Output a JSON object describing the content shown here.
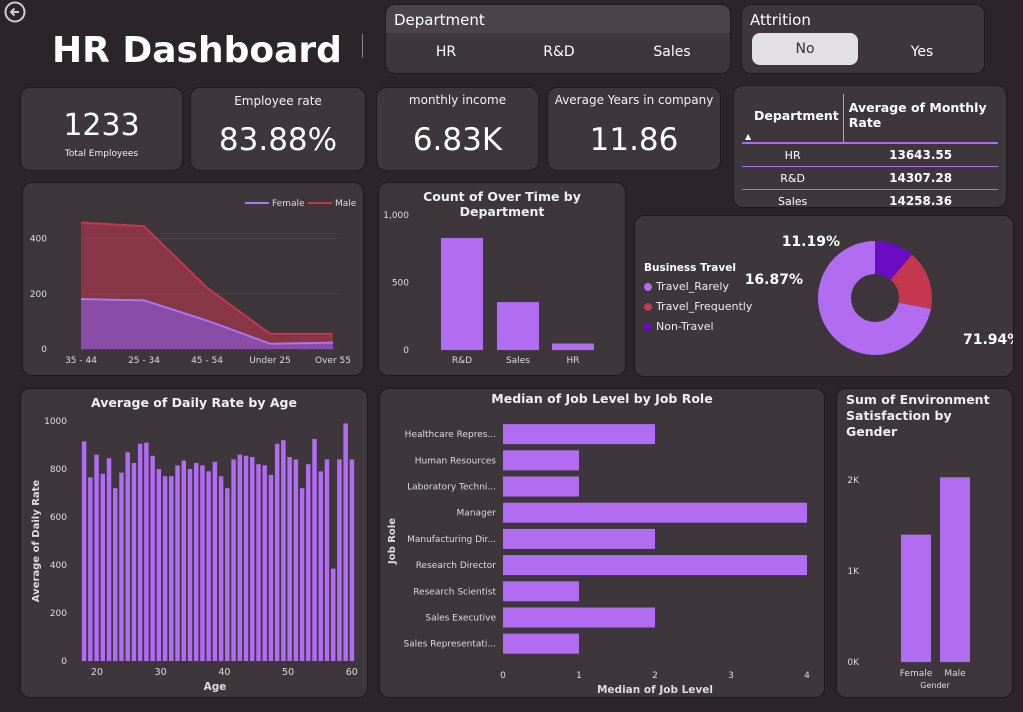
{
  "title": "HR Dashboard",
  "back_icon": "back-arrow-icon",
  "colors": {
    "purple": "#b26cf2",
    "female_line": "#a876ee",
    "male_line": "#c5374f",
    "travel_rarely": "#b26cf2",
    "travel_frequently": "#c5374f",
    "non_travel": "#6a0bc5"
  },
  "department_slicer": {
    "title": "Department",
    "items": [
      "HR",
      "R&D",
      "Sales"
    ]
  },
  "attrition_slicer": {
    "title": "Attrition",
    "items": [
      "No",
      "Yes"
    ],
    "selected": "No"
  },
  "kpis": {
    "total": {
      "value": "1233",
      "label": "Total Employees"
    },
    "employee_rate": {
      "label": "Employee rate",
      "value": "83.88%"
    },
    "monthly_income": {
      "label": "monthly income",
      "value": "6.83K"
    },
    "avg_years": {
      "label": "Average Years in company",
      "value": "11.86"
    }
  },
  "dept_table": {
    "headers": [
      "Department",
      "Average of Monthly Rate"
    ],
    "rows": [
      {
        "dept": "HR",
        "value": "13643.55"
      },
      {
        "dept": "R&D",
        "value": "14307.28"
      },
      {
        "dept": "Sales",
        "value": "14258.36"
      }
    ]
  },
  "chart_data": [
    {
      "type": "area",
      "title": "",
      "categories": [
        "35 - 44",
        "25 - 34",
        "45 - 54",
        "Under 25",
        "Over 55"
      ],
      "series": [
        {
          "name": "Female",
          "values": [
            181,
            176,
            103,
            19,
            23
          ]
        },
        {
          "name": "Male",
          "values": [
            458,
            445,
            222,
            55,
            55
          ]
        }
      ],
      "y_ticks": [
        "0",
        "200",
        "400"
      ],
      "ylim": [
        0,
        500
      ],
      "legend": "top-right"
    },
    {
      "type": "bar",
      "title": "Count of Over Time by Department",
      "categories": [
        "R&D",
        "Sales",
        "HR"
      ],
      "values": [
        830,
        355,
        48
      ],
      "y_ticks": [
        "0",
        "500",
        "1,000"
      ],
      "ylim": [
        0,
        1000
      ]
    },
    {
      "type": "pie",
      "title": "",
      "legend_title": "Business Travel",
      "labels": [
        "Travel_Rarely",
        "Travel_Frequently",
        "Non-Travel"
      ],
      "values": [
        71.94,
        16.87,
        11.19
      ],
      "value_labels": [
        "71.94%",
        "16.87%",
        "11.19%"
      ],
      "legend": "left"
    },
    {
      "type": "bar",
      "title": "Average of Daily Rate by Age",
      "xlabel": "Age",
      "ylabel": "Average of Daily Rate",
      "x": [
        18,
        19,
        20,
        21,
        22,
        23,
        24,
        25,
        26,
        27,
        28,
        29,
        30,
        31,
        32,
        33,
        34,
        35,
        36,
        37,
        38,
        39,
        40,
        41,
        42,
        43,
        44,
        45,
        46,
        47,
        48,
        49,
        50,
        51,
        52,
        53,
        54,
        55,
        56,
        57,
        58,
        59,
        60
      ],
      "values": [
        915,
        765,
        860,
        780,
        845,
        720,
        785,
        870,
        825,
        905,
        910,
        855,
        800,
        770,
        770,
        815,
        835,
        800,
        825,
        815,
        790,
        830,
        770,
        720,
        840,
        860,
        855,
        850,
        820,
        815,
        775,
        905,
        920,
        850,
        840,
        720,
        820,
        925,
        790,
        840,
        385,
        840,
        990,
        840
      ],
      "x_ticks": [
        "20",
        "30",
        "40",
        "50",
        "60"
      ],
      "y_ticks": [
        "0",
        "200",
        "400",
        "600",
        "800",
        "1000"
      ],
      "ylim": [
        0,
        1000
      ]
    },
    {
      "type": "bar",
      "orientation": "horizontal",
      "title": "Median of Job Level by Job Role",
      "xlabel": "Median of Job Level",
      "ylabel": "Job Role",
      "categories": [
        "Healthcare Repres...",
        "Human Resources",
        "Laboratory Techni...",
        "Manager",
        "Manufacturing Dir...",
        "Research Director",
        "Research Scientist",
        "Sales Executive",
        "Sales Representati..."
      ],
      "values": [
        2,
        1,
        1,
        4,
        2,
        4,
        1,
        2,
        1
      ],
      "x_ticks": [
        "0",
        "1",
        "2",
        "3",
        "4"
      ],
      "xlim": [
        0,
        4
      ]
    },
    {
      "type": "bar",
      "title": "Sum of Environment Satisfaction by Gender",
      "xlabel": "Gender",
      "categories": [
        "Female",
        "Male"
      ],
      "values": [
        1400,
        2030
      ],
      "y_ticks": [
        "0K",
        "1K",
        "2K"
      ],
      "ylim": [
        0,
        2200
      ]
    }
  ]
}
